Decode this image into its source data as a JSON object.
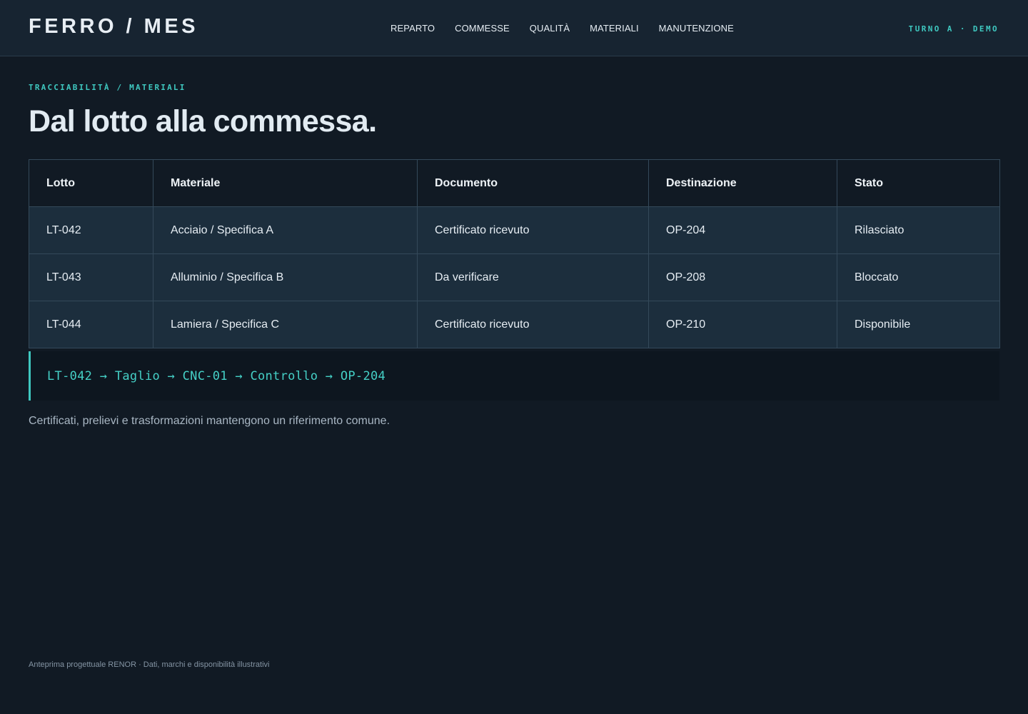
{
  "header": {
    "brand": "FERRO / MES",
    "nav": [
      "REPARTO",
      "COMMESSE",
      "QUALITÀ",
      "MATERIALI",
      "MANUTENZIONE"
    ],
    "shift": "TURNO A · DEMO"
  },
  "breadcrumb": "TRACCIABILITÀ / MATERIALI",
  "title": "Dal lotto alla commessa.",
  "table": {
    "columns": [
      "Lotto",
      "Materiale",
      "Documento",
      "Destinazione",
      "Stato"
    ],
    "rows": [
      [
        "LT-042",
        "Acciaio / Specifica A",
        "Certificato ricevuto",
        "OP-204",
        "Rilasciato"
      ],
      [
        "LT-043",
        "Alluminio / Specifica B",
        "Da verificare",
        "OP-208",
        "Bloccato"
      ],
      [
        "LT-044",
        "Lamiera / Specifica C",
        "Certificato ricevuto",
        "OP-210",
        "Disponibile"
      ]
    ]
  },
  "flow": "LT-042 → Taglio → CNC-01 → Controllo → OP-204",
  "note": "Certificati, prelievi e trasformazioni mantengono un riferimento comune.",
  "footer": "Anteprima progettuale RENOR · Dati, marchi e disponibilità illustrativi",
  "colors": {
    "accent": "#3fc8c0",
    "background": "#111a24",
    "header_background": "#172431",
    "row_background": "#1c2e3d"
  }
}
